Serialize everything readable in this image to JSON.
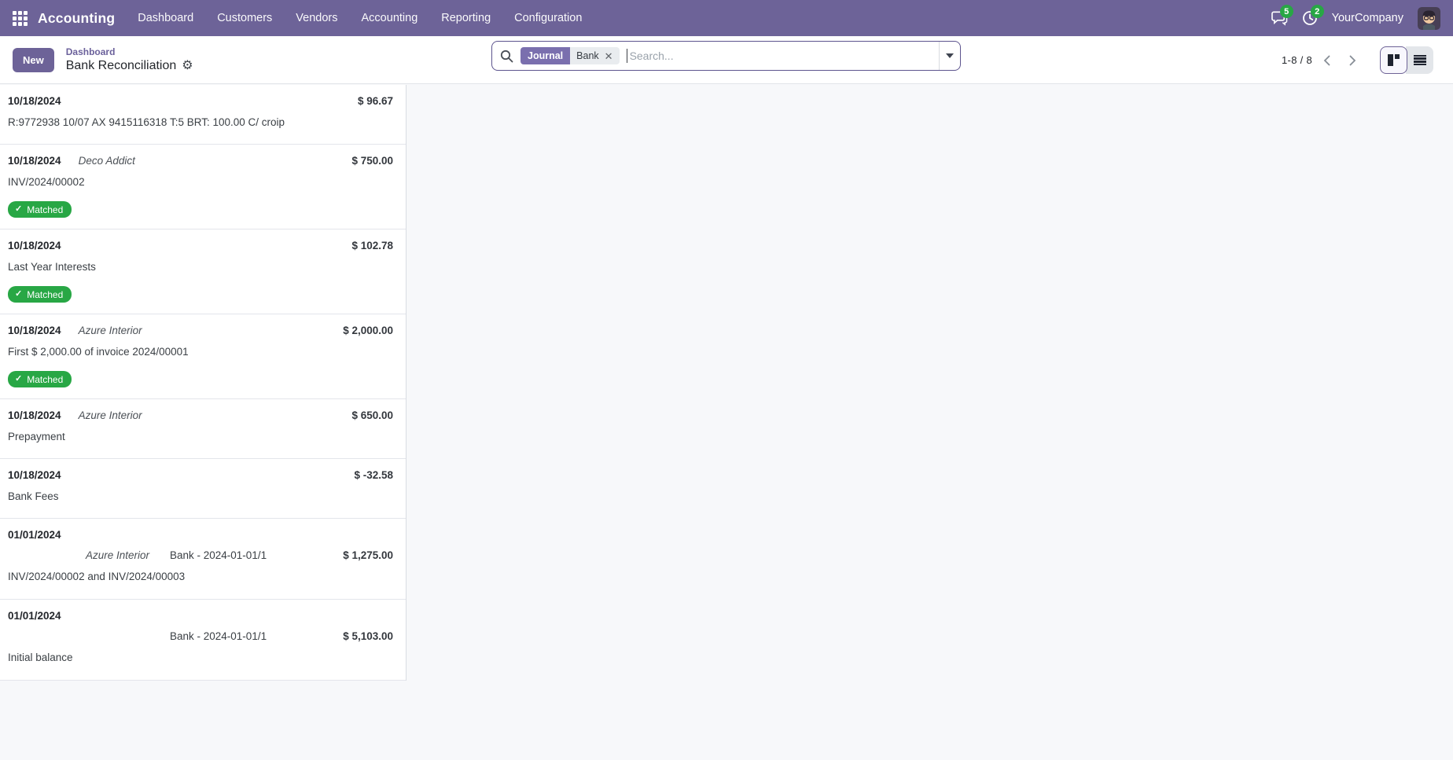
{
  "navbar": {
    "brand": "Accounting",
    "menu_items": [
      "Dashboard",
      "Customers",
      "Vendors",
      "Accounting",
      "Reporting",
      "Configuration"
    ],
    "messages_badge": "5",
    "activities_badge": "2",
    "company": "YourCompany"
  },
  "control_bar": {
    "new_button": "New",
    "breadcrumb_parent": "Dashboard",
    "title": "Bank Reconciliation",
    "search": {
      "facet_category": "Journal",
      "facet_value": "Bank",
      "placeholder": "Search..."
    },
    "pager_display": "1-8 / 8"
  },
  "matched_label": "Matched",
  "cards": [
    {
      "date": "10/18/2024",
      "partner": "",
      "statement": "",
      "label": "R:9772938 10/07 AX 9415116318 T:5 BRT: 100.00 C/ croip",
      "amount": "$ 96.67",
      "matched": false,
      "layout": "inline"
    },
    {
      "date": "10/18/2024",
      "partner": "Deco Addict",
      "statement": "",
      "label": "INV/2024/00002",
      "amount": "$ 750.00",
      "matched": true,
      "layout": "inline"
    },
    {
      "date": "10/18/2024",
      "partner": "",
      "statement": "",
      "label": "Last Year Interests",
      "amount": "$ 102.78",
      "matched": true,
      "layout": "inline"
    },
    {
      "date": "10/18/2024",
      "partner": "Azure Interior",
      "statement": "",
      "label": "First $ 2,000.00 of invoice 2024/00001",
      "amount": "$ 2,000.00",
      "matched": true,
      "layout": "inline"
    },
    {
      "date": "10/18/2024",
      "partner": "Azure Interior",
      "statement": "",
      "label": "Prepayment",
      "amount": "$ 650.00",
      "matched": false,
      "layout": "inline"
    },
    {
      "date": "10/18/2024",
      "partner": "",
      "statement": "",
      "label": "Bank Fees",
      "amount": "$ -32.58",
      "matched": false,
      "layout": "inline"
    },
    {
      "date": "01/01/2024",
      "partner": "Azure Interior",
      "statement": "Bank - 2024-01-01/1",
      "label": "INV/2024/00002 and INV/2024/00003",
      "amount": "$ 1,275.00",
      "matched": false,
      "layout": "stacked"
    },
    {
      "date": "01/01/2024",
      "partner": "",
      "statement": "Bank - 2024-01-01/1",
      "label": "Initial balance",
      "amount": "$ 5,103.00",
      "matched": false,
      "layout": "stacked"
    }
  ],
  "colors": {
    "navbar": "#6d6398",
    "accent": "#6d6398",
    "badge_green": "#28a745",
    "content_bg": "#f7f8fa"
  }
}
